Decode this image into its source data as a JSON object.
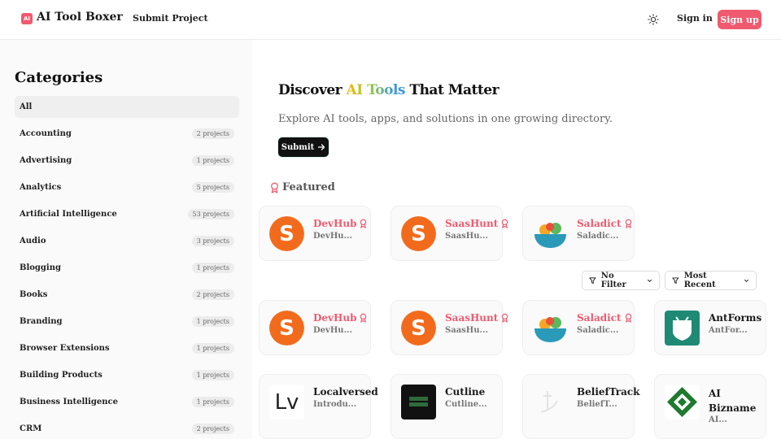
{
  "header": {
    "logo_badge": "AI",
    "logo_text": "AI Tool Boxer",
    "nav_submit": "Submit Project",
    "signin": "Sign in",
    "signup": "Sign up"
  },
  "sidebar": {
    "title": "Categories",
    "items": [
      {
        "name": "All",
        "count": ""
      },
      {
        "name": "Accounting",
        "count": "2 projects"
      },
      {
        "name": "Advertising",
        "count": "1 projects"
      },
      {
        "name": "Analytics",
        "count": "5 projects"
      },
      {
        "name": "Artificial Intelligence",
        "count": "53 projects"
      },
      {
        "name": "Audio",
        "count": "3 projects"
      },
      {
        "name": "Blogging",
        "count": "1 projects"
      },
      {
        "name": "Books",
        "count": "2 projects"
      },
      {
        "name": "Branding",
        "count": "1 projects"
      },
      {
        "name": "Browser Extensions",
        "count": "1 projects"
      },
      {
        "name": "Building Products",
        "count": "1 projects"
      },
      {
        "name": "Business Intelligence",
        "count": "1 projects"
      },
      {
        "name": "CRM",
        "count": "2 projects"
      }
    ]
  },
  "hero": {
    "title_pre": "Discover ",
    "title_highlight": "AI Tools",
    "title_post": " That Matter",
    "subtitle": "Explore AI tools, apps, and solutions in one growing directory.",
    "submit": "Submit"
  },
  "featured": {
    "label": "Featured",
    "cards": [
      {
        "name": "DevHub",
        "desc": "DevHu..."
      },
      {
        "name": "SaasHunt",
        "desc": "SaasHu..."
      },
      {
        "name": "Saladict",
        "desc": "Saladic..."
      }
    ]
  },
  "filters": {
    "filter_label": "No Filter",
    "sort_label": "Most Recent"
  },
  "grid": {
    "row1": [
      {
        "name": "DevHub",
        "desc": "DevHu..."
      },
      {
        "name": "SaasHunt",
        "desc": "SaasHu..."
      },
      {
        "name": "Saladict",
        "desc": "Saladic..."
      },
      {
        "name": "AntForms",
        "desc": "AntFor..."
      }
    ],
    "row2": [
      {
        "name": "Localversed",
        "desc": "Introdu..."
      },
      {
        "name": "Cutline",
        "desc": "Cutline..."
      },
      {
        "name": "BeliefTrack",
        "desc": "BeliefT..."
      },
      {
        "name": "AI Bizname",
        "desc": "AI..."
      }
    ]
  },
  "colors": {
    "accent": "#ef5a6f",
    "orange_logo": "#f26b1d",
    "antforms": "#1f8a73"
  }
}
